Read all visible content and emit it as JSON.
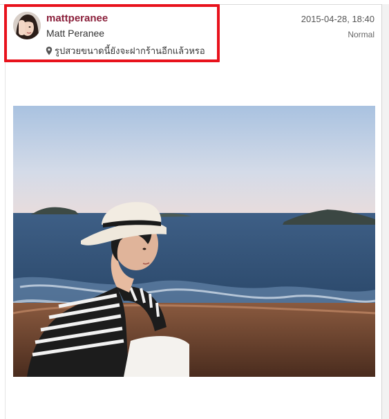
{
  "post": {
    "username": "mattperanee",
    "full_name": "Matt Peranee",
    "location": "รูปสวยขนาดนี้ยังจะฝากร้านอีกแล้วหรอ",
    "timestamp": "2015-04-28, 18:40",
    "filter": "Normal"
  },
  "icons": {
    "location": "map-pin-icon",
    "avatar": "profile-avatar"
  },
  "colors": {
    "username": "#8a1f3a",
    "highlight_box": "#e8121c"
  }
}
